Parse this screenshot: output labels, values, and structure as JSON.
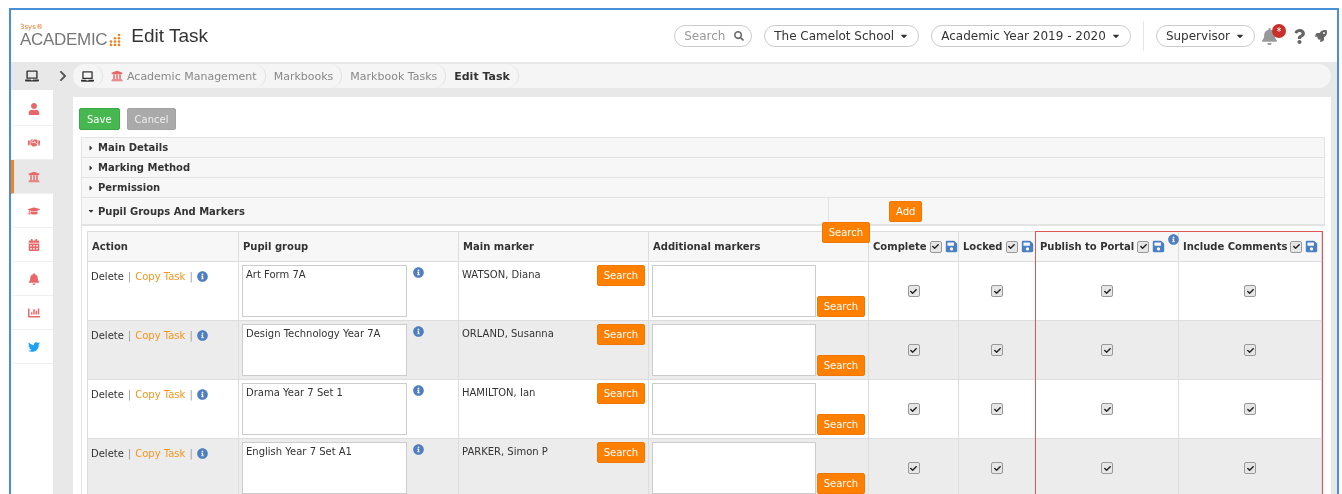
{
  "header": {
    "logo_mark": "3sys®",
    "logo": "ACADEMIC",
    "title": "Edit Task",
    "search": {
      "placeholder": "Search"
    },
    "school": "The Camelot School",
    "year": "Academic Year 2019 - 2020",
    "role": "Supervisor",
    "notification_badge": "*"
  },
  "sidebar": {
    "items": [
      {
        "selected": false
      },
      {
        "selected": false
      },
      {
        "selected": true
      },
      {
        "selected": false
      },
      {
        "selected": false
      },
      {
        "selected": false
      },
      {
        "selected": false
      },
      {
        "selected": false
      }
    ]
  },
  "breadcrumb": [
    {
      "label": "Academic Management",
      "selected": false
    },
    {
      "label": "Markbooks",
      "selected": false
    },
    {
      "label": "Markbook Tasks",
      "selected": false
    },
    {
      "label": "Edit Task",
      "selected": true
    }
  ],
  "buttons": {
    "save": "Save",
    "cancel": {
      "label": "Cancel",
      "disabled": true
    }
  },
  "sections": [
    {
      "title": "Main Details",
      "expanded": false
    },
    {
      "title": "Marking Method",
      "expanded": false
    },
    {
      "title": "Permission",
      "expanded": false
    },
    {
      "title": "Pupil Groups And Markers",
      "expanded": true
    }
  ],
  "add_button": "Add",
  "header_search_button": "Search",
  "columns": [
    {
      "label": "Action",
      "kind": "text"
    },
    {
      "label": "Pupil group",
      "kind": "text"
    },
    {
      "label": "Main marker",
      "kind": "text"
    },
    {
      "label": "Additional markers",
      "kind": "text"
    },
    {
      "label": "Complete",
      "kind": "toggle",
      "checked": true
    },
    {
      "label": "Locked",
      "kind": "toggle",
      "checked": true
    },
    {
      "label": "Publish to Portal",
      "kind": "toggle",
      "checked": true,
      "info": true,
      "highlighted": true
    },
    {
      "label": "Include Comments",
      "kind": "toggle",
      "checked": true,
      "highlighted": true
    }
  ],
  "rows": [
    {
      "delete": "Delete",
      "separator": "|",
      "copy": "Copy Task",
      "separator_2": "|",
      "pupil_group": "Art Form 7A",
      "main_marker": "WATSON, Diana",
      "marker_search": "Search",
      "additional_search": "Search",
      "flags": [
        true,
        true,
        true,
        true
      ]
    },
    {
      "delete": "Delete",
      "separator": "|",
      "copy": "Copy Task",
      "separator_2": "|",
      "pupil_group": "Design Technology Year 7A",
      "main_marker": "ORLAND, Susanna",
      "marker_search": "Search",
      "additional_search": "Search",
      "flags": [
        true,
        true,
        true,
        true
      ]
    },
    {
      "delete": "Delete",
      "separator": "|",
      "copy": "Copy Task",
      "separator_2": "|",
      "pupil_group": "Drama Year 7 Set 1",
      "main_marker": "HAMILTON, Ian",
      "marker_search": "Search",
      "additional_search": "Search",
      "flags": [
        true,
        true,
        true,
        true
      ]
    },
    {
      "delete": "Delete",
      "separator": "|",
      "copy": "Copy Task",
      "separator_2": "|",
      "pupil_group": "English Year 7 Set A1",
      "main_marker": "PARKER, Simon P",
      "marker_search": "Search",
      "additional_search": "Search",
      "flags": [
        true,
        true,
        true,
        true
      ]
    }
  ]
}
